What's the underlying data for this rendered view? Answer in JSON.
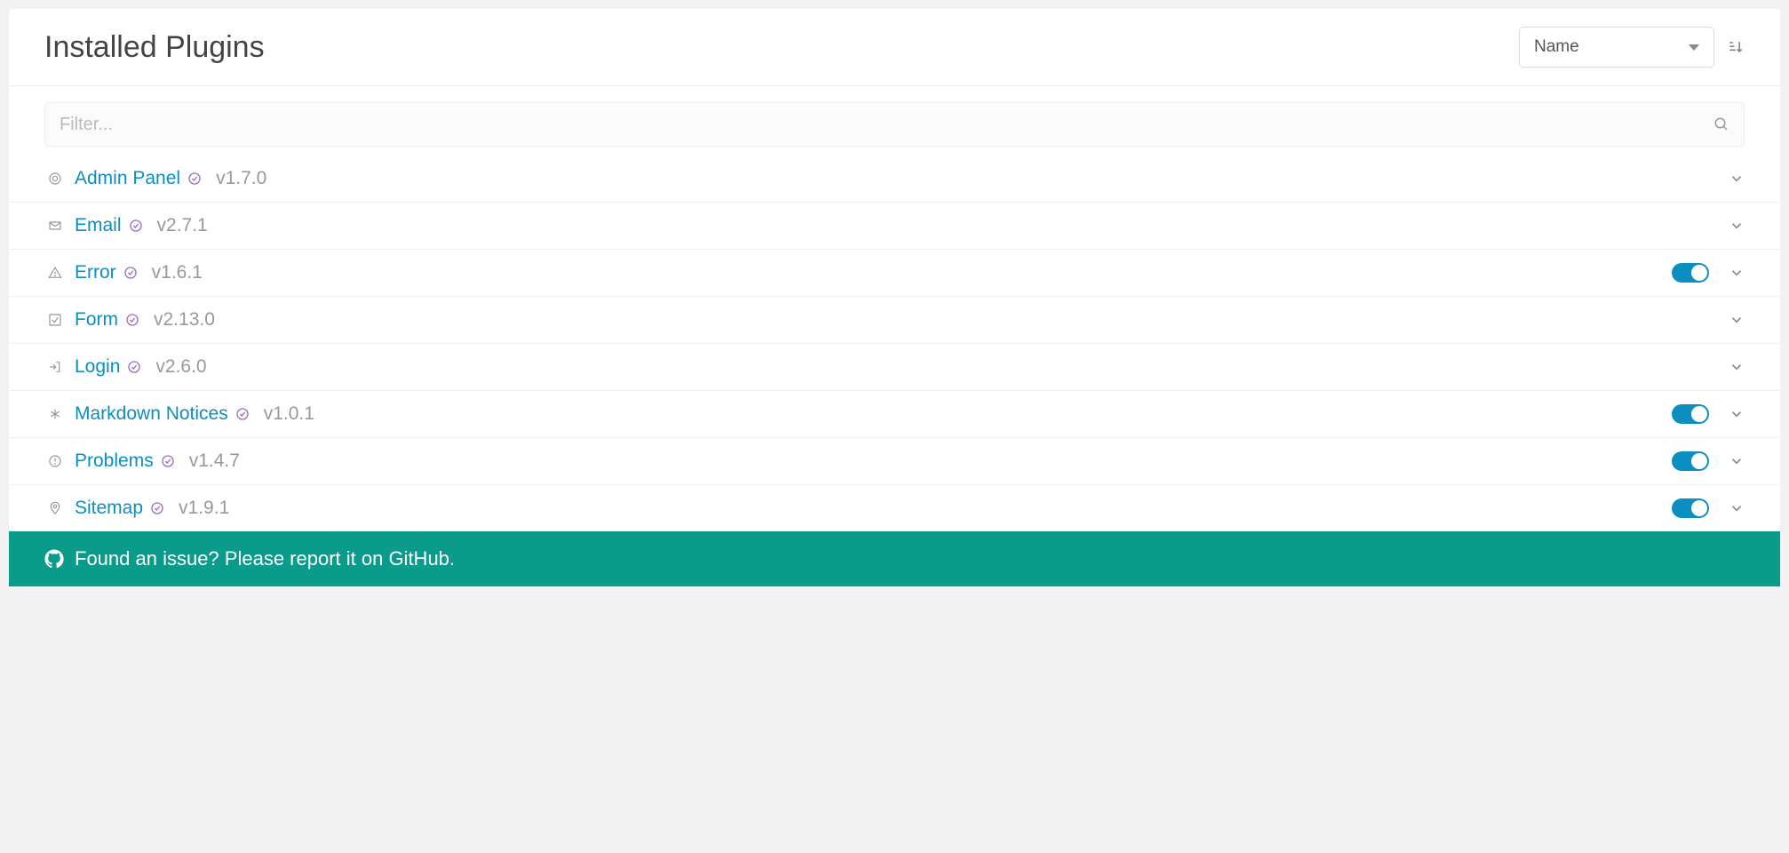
{
  "header": {
    "title": "Installed Plugins",
    "sort_selected": "Name"
  },
  "filter": {
    "placeholder": "Filter..."
  },
  "plugins": [
    {
      "name": "Admin Panel",
      "version": "v1.7.0",
      "icon": "grav",
      "toggle": null
    },
    {
      "name": "Email",
      "version": "v2.7.1",
      "icon": "envelope",
      "toggle": null
    },
    {
      "name": "Error",
      "version": "v1.6.1",
      "icon": "warning",
      "toggle": true
    },
    {
      "name": "Form",
      "version": "v2.13.0",
      "icon": "check",
      "toggle": null
    },
    {
      "name": "Login",
      "version": "v2.6.0",
      "icon": "signin",
      "toggle": null
    },
    {
      "name": "Markdown Notices",
      "version": "v1.0.1",
      "icon": "asterisk",
      "toggle": true
    },
    {
      "name": "Problems",
      "version": "v1.4.7",
      "icon": "exclaim",
      "toggle": true
    },
    {
      "name": "Sitemap",
      "version": "v1.9.1",
      "icon": "map",
      "toggle": true
    }
  ],
  "footer": {
    "text": "Found an issue? Please report it on GitHub."
  }
}
